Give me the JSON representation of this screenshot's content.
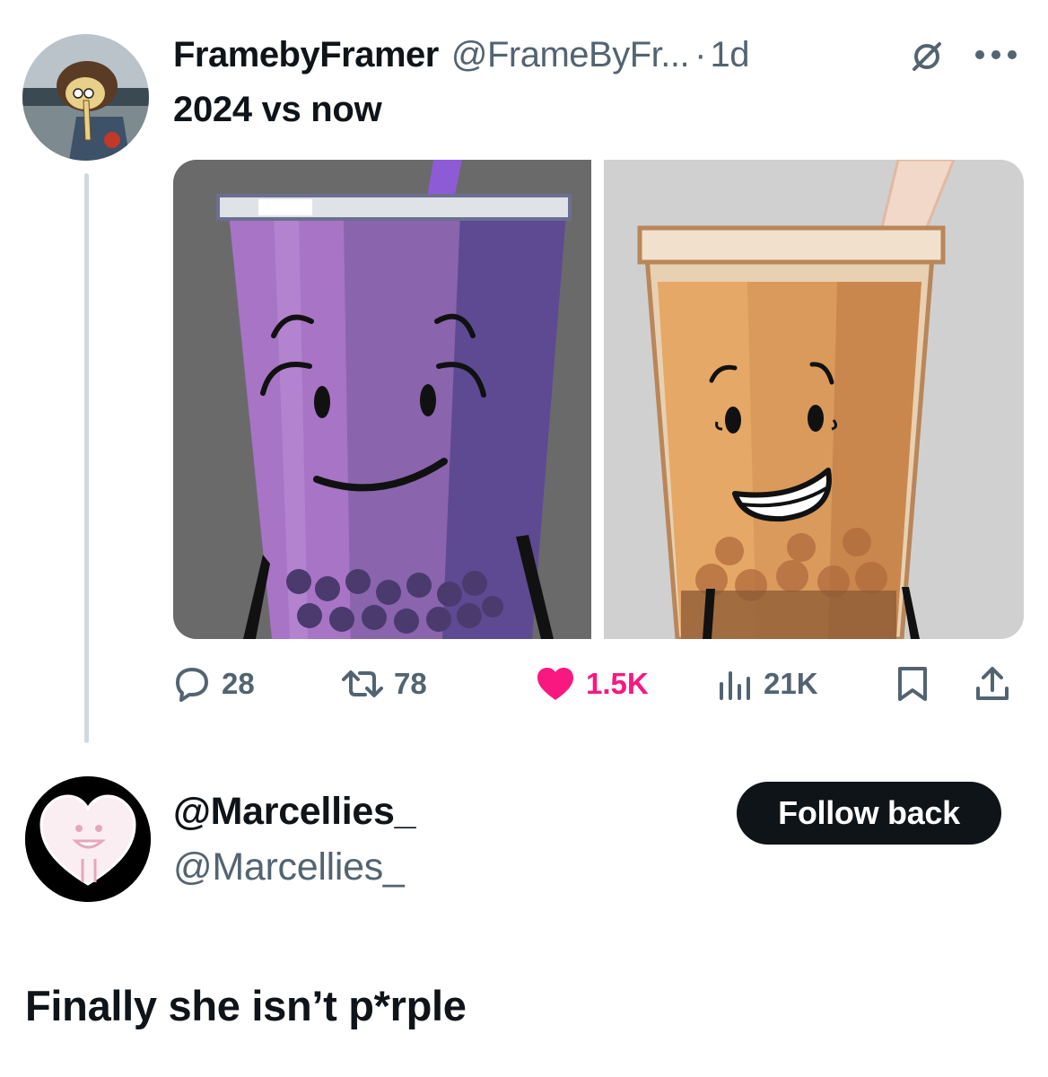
{
  "tweet": {
    "display_name": "FramebyFramer",
    "handle": "@FrameByFr...",
    "separator": "·",
    "time": "1d",
    "text": "2024 vs now",
    "icons": {
      "grok": "grok-icon",
      "more": "more-options-icon"
    },
    "media": {
      "panels": [
        "purple-boba-character-2024",
        "brown-boba-character-now"
      ]
    },
    "stats": {
      "replies": "28",
      "reposts": "78",
      "likes": "1.5K",
      "views": "21K"
    },
    "colors": {
      "like": "#f91880",
      "muted": "#536471"
    }
  },
  "reply": {
    "name": "@Marcellies_",
    "handle": "@Marcellies_",
    "follow_label": "Follow back",
    "text": "Finally she isn’t p*rple"
  }
}
